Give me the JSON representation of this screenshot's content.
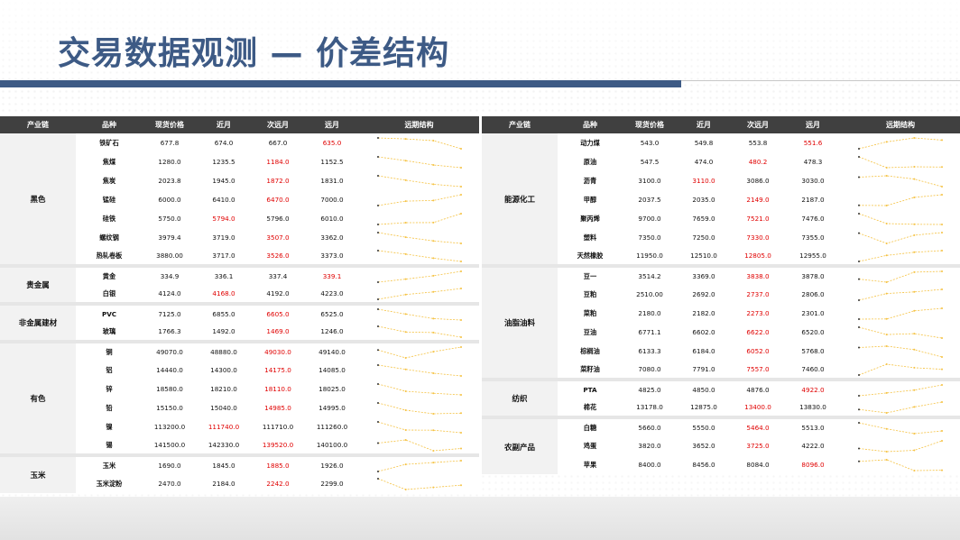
{
  "page": {
    "title": "交易数据观测 — 价差结构"
  },
  "columns": [
    "产业链",
    "品种",
    "现货价格",
    "近月",
    "次远月",
    "远月",
    "远期结构"
  ],
  "left_groups": [
    {
      "chain": "黑色",
      "rows": [
        {
          "name": "铁矿石",
          "spot": "677.8",
          "near": "674.0",
          "mid": "667.0",
          "far": "635.0",
          "red": "far"
        },
        {
          "name": "焦煤",
          "spot": "1280.0",
          "near": "1235.5",
          "mid": "1184.0",
          "far": "1152.5",
          "red": "mid"
        },
        {
          "name": "焦炭",
          "spot": "2023.8",
          "near": "1945.0",
          "mid": "1872.0",
          "far": "1831.0",
          "red": "mid"
        },
        {
          "name": "锰硅",
          "spot": "6000.0",
          "near": "6410.0",
          "mid": "6470.0",
          "far": "7000.0",
          "red": "mid"
        },
        {
          "name": "硅铁",
          "spot": "5750.0",
          "near": "5794.0",
          "mid": "5796.0",
          "far": "6010.0",
          "red": "near"
        },
        {
          "name": "螺纹钢",
          "spot": "3979.4",
          "near": "3719.0",
          "mid": "3507.0",
          "far": "3362.0",
          "red": "mid"
        },
        {
          "name": "热轧卷板",
          "spot": "3880.00",
          "near": "3717.0",
          "mid": "3526.0",
          "far": "3373.0",
          "red": "mid"
        }
      ]
    },
    {
      "chain": "贵金属",
      "rows": [
        {
          "name": "黄金",
          "spot": "334.9",
          "near": "336.1",
          "mid": "337.4",
          "far": "339.1",
          "red": "far"
        },
        {
          "name": "白银",
          "spot": "4124.0",
          "near": "4168.0",
          "mid": "4192.0",
          "far": "4223.0",
          "red": "near"
        }
      ]
    },
    {
      "chain": "非金属建材",
      "rows": [
        {
          "name": "PVC",
          "spot": "7125.0",
          "near": "6855.0",
          "mid": "6605.0",
          "far": "6525.0",
          "red": "mid"
        },
        {
          "name": "玻璃",
          "spot": "1766.3",
          "near": "1492.0",
          "mid": "1469.0",
          "far": "1246.0",
          "red": "mid"
        }
      ]
    },
    {
      "chain": "有色",
      "rows": [
        {
          "name": "铜",
          "spot": "49070.0",
          "near": "48880.0",
          "mid": "49030.0",
          "far": "49140.0",
          "red": "mid"
        },
        {
          "name": "铝",
          "spot": "14440.0",
          "near": "14300.0",
          "mid": "14175.0",
          "far": "14085.0",
          "red": "mid"
        },
        {
          "name": "锌",
          "spot": "18580.0",
          "near": "18210.0",
          "mid": "18110.0",
          "far": "18025.0",
          "red": "mid"
        },
        {
          "name": "铅",
          "spot": "15150.0",
          "near": "15040.0",
          "mid": "14985.0",
          "far": "14995.0",
          "red": "mid"
        },
        {
          "name": "镍",
          "spot": "113200.0",
          "near": "111740.0",
          "mid": "111710.0",
          "far": "111260.0",
          "red": "near"
        },
        {
          "name": "锡",
          "spot": "141500.0",
          "near": "142330.0",
          "mid": "139520.0",
          "far": "140100.0",
          "red": "mid"
        }
      ]
    },
    {
      "chain": "玉米",
      "rows": [
        {
          "name": "玉米",
          "spot": "1690.0",
          "near": "1845.0",
          "mid": "1885.0",
          "far": "1926.0",
          "red": "mid"
        },
        {
          "name": "玉米淀粉",
          "spot": "2470.0",
          "near": "2184.0",
          "mid": "2242.0",
          "far": "2299.0",
          "red": "mid"
        }
      ]
    }
  ],
  "right_groups": [
    {
      "chain": "能源化工",
      "rows": [
        {
          "name": "动力煤",
          "spot": "543.0",
          "near": "549.8",
          "mid": "553.8",
          "far": "551.6",
          "red": "far"
        },
        {
          "name": "原油",
          "spot": "547.5",
          "near": "474.0",
          "mid": "480.2",
          "far": "478.3",
          "red": "mid"
        },
        {
          "name": "沥青",
          "spot": "3100.0",
          "near": "3110.0",
          "mid": "3086.0",
          "far": "3030.0",
          "red": "near"
        },
        {
          "name": "甲醇",
          "spot": "2037.5",
          "near": "2035.0",
          "mid": "2149.0",
          "far": "2187.0",
          "red": "mid"
        },
        {
          "name": "聚丙烯",
          "spot": "9700.0",
          "near": "7659.0",
          "mid": "7521.0",
          "far": "7476.0",
          "red": "mid"
        },
        {
          "name": "塑料",
          "spot": "7350.0",
          "near": "7250.0",
          "mid": "7330.0",
          "far": "7355.0",
          "red": "mid"
        },
        {
          "name": "天然橡胶",
          "spot": "11950.0",
          "near": "12510.0",
          "mid": "12805.0",
          "far": "12955.0",
          "red": "mid"
        }
      ]
    },
    {
      "chain": "油脂油料",
      "rows": [
        {
          "name": "豆一",
          "spot": "3514.2",
          "near": "3369.0",
          "mid": "3838.0",
          "far": "3878.0",
          "red": "mid"
        },
        {
          "name": "豆粕",
          "spot": "2510.00",
          "near": "2692.0",
          "mid": "2737.0",
          "far": "2806.0",
          "red": "mid"
        },
        {
          "name": "菜粕",
          "spot": "2180.0",
          "near": "2182.0",
          "mid": "2273.0",
          "far": "2301.0",
          "red": "mid"
        },
        {
          "name": "豆油",
          "spot": "6771.1",
          "near": "6602.0",
          "mid": "6622.0",
          "far": "6520.0",
          "red": "mid"
        },
        {
          "name": "棕榈油",
          "spot": "6133.3",
          "near": "6184.0",
          "mid": "6052.0",
          "far": "5768.0",
          "red": "mid"
        },
        {
          "name": "菜籽油",
          "spot": "7080.0",
          "near": "7791.0",
          "mid": "7557.0",
          "far": "7460.0",
          "red": "mid"
        }
      ]
    },
    {
      "chain": "纺织",
      "rows": [
        {
          "name": "PTA",
          "spot": "4825.0",
          "near": "4850.0",
          "mid": "4876.0",
          "far": "4922.0",
          "red": "far"
        },
        {
          "name": "棉花",
          "spot": "13178.0",
          "near": "12875.0",
          "mid": "13400.0",
          "far": "13830.0",
          "red": "mid"
        }
      ]
    },
    {
      "chain": "农副产品",
      "rows": [
        {
          "name": "白糖",
          "spot": "5660.0",
          "near": "5550.0",
          "mid": "5464.0",
          "far": "5513.0",
          "red": "mid"
        },
        {
          "name": "鸡蛋",
          "spot": "3820.0",
          "near": "3652.0",
          "mid": "3725.0",
          "far": "4222.0",
          "red": "mid"
        },
        {
          "name": "苹果",
          "spot": "8400.0",
          "near": "8456.0",
          "mid": "8084.0",
          "far": "8096.0",
          "red": "far"
        }
      ]
    }
  ],
  "colors": {
    "title": "#3d5a85",
    "header_bg": "#404040",
    "highlight": "#e00000",
    "spark": "#f5c242"
  }
}
